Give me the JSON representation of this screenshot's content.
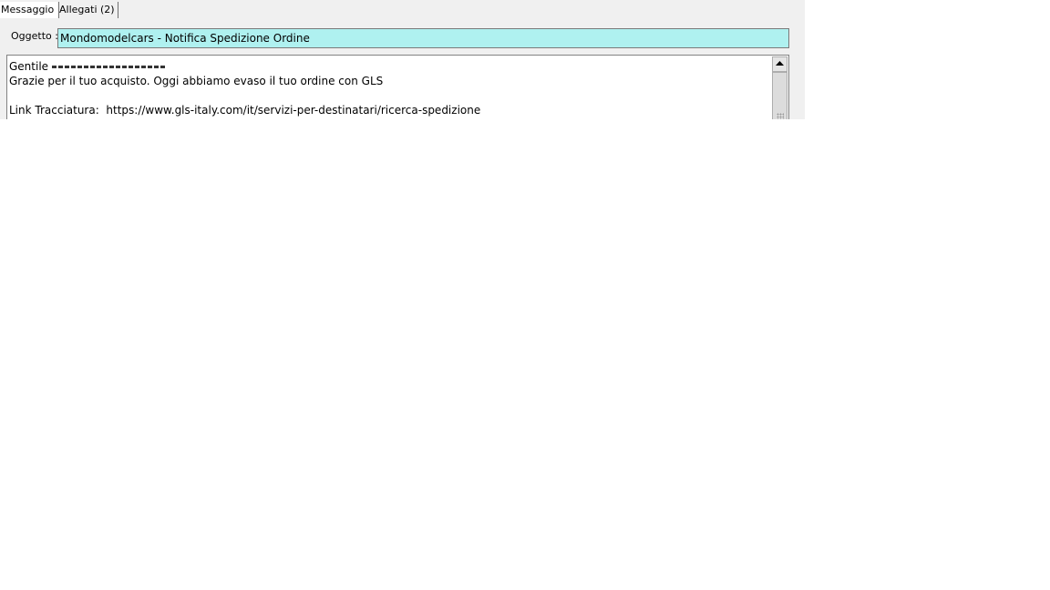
{
  "tabs": [
    {
      "label": "Messaggio",
      "active": true
    },
    {
      "label": "Allegati (2)",
      "active": false
    }
  ],
  "subject": {
    "label": "Oggetto :",
    "value": "Mondomodelcars - Notifica Spedizione Ordine"
  },
  "message": {
    "greeting": "Gentile ",
    "line2": "Grazie per il tuo acquisto. Oggi abbiamo evaso il tuo ordine con GLS",
    "line3": "",
    "line4": "Link Tracciatura:  https://www.gls-italy.com/it/servizi-per-destinatari/ricerca-spedizione"
  },
  "colors": {
    "subject_bg": "#aff1f0",
    "panel_bg": "#f0f0f0"
  },
  "icons": {
    "scroll_up": "triangle-up-icon",
    "grip": "grip-icon"
  }
}
